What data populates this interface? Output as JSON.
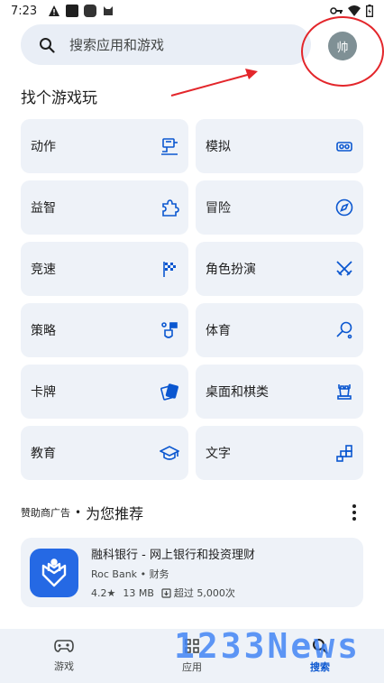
{
  "status_bar": {
    "time": "7:23"
  },
  "search": {
    "placeholder": "搜索应用和游戏"
  },
  "profile": {
    "initial": "帅"
  },
  "section": {
    "title": "找个游戏玩"
  },
  "categories": [
    {
      "label": "动作",
      "icon": "action-icon"
    },
    {
      "label": "模拟",
      "icon": "vr-headset-icon"
    },
    {
      "label": "益智",
      "icon": "puzzle-icon"
    },
    {
      "label": "冒险",
      "icon": "compass-icon"
    },
    {
      "label": "竞速",
      "icon": "checkered-flag-icon"
    },
    {
      "label": "角色扮演",
      "icon": "crossed-swords-icon"
    },
    {
      "label": "策略",
      "icon": "strategy-icon"
    },
    {
      "label": "体育",
      "icon": "racket-icon"
    },
    {
      "label": "卡牌",
      "icon": "cards-icon"
    },
    {
      "label": "桌面和棋类",
      "icon": "chess-rook-icon"
    },
    {
      "label": "教育",
      "icon": "graduation-cap-icon"
    },
    {
      "label": "文字",
      "icon": "word-blocks-icon"
    }
  ],
  "ads": {
    "sponsored_label": "赞助商广告",
    "separator": "•",
    "title": "为您推荐",
    "app": {
      "name": "融科银行 - 网上银行和投资理财",
      "developer": "Roc Bank",
      "category": "财务",
      "rating": "4.2★",
      "size": "13 MB",
      "downloads": "超过 5,000次"
    }
  },
  "nav": {
    "games": "游戏",
    "apps": "应用",
    "search": "搜索"
  },
  "watermark": "1233News",
  "colors": {
    "accent": "#0b57d0",
    "annotation": "#e3262b",
    "card_bg": "#eef2f8"
  }
}
